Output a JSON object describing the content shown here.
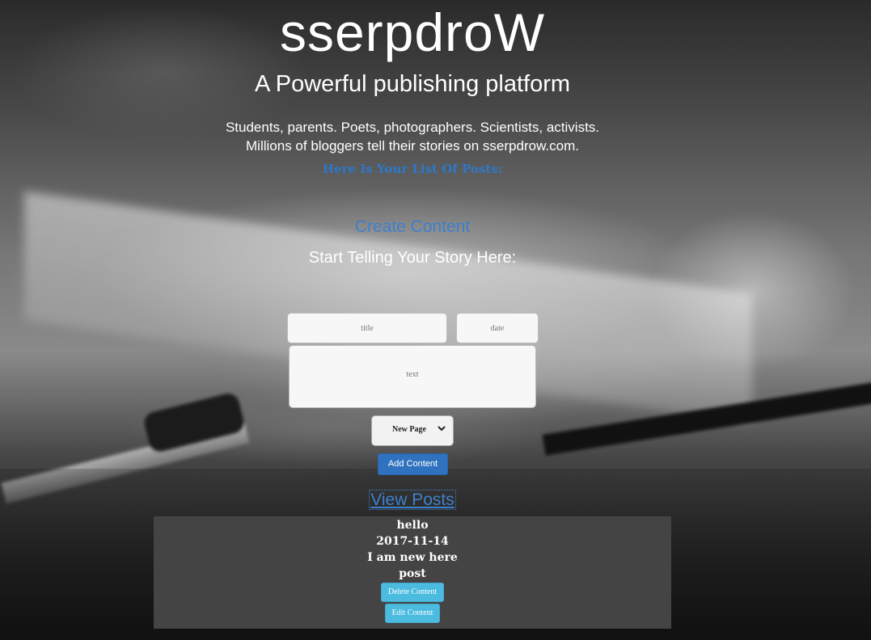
{
  "header": {
    "brand": "sserpdroW",
    "tagline": "A Powerful publishing platform",
    "description_line1": "Students, parents. Poets, photographers. Scientists, activists.",
    "description_line2": "Millions of bloggers tell their stories on sserpdrow.com.",
    "list_heading": "Here Is Your List Of Posts:"
  },
  "create": {
    "heading": "Create Content",
    "subheading": "Start Telling Your Story Here:",
    "title_placeholder": "title",
    "date_placeholder": "date",
    "text_placeholder": "text",
    "type_selected": "New Page",
    "add_button": "Add Content"
  },
  "view": {
    "link": "View Posts"
  },
  "posts": [
    {
      "title": "hello",
      "date": "2017-11-14",
      "text": "I am new here",
      "type": "post",
      "delete_label": "Delete Content",
      "edit_label": "Edit Content"
    }
  ],
  "colors": {
    "link_blue": "#3d80cc",
    "heading_blue": "#2d78c9",
    "primary_button": "#2f72bf",
    "info_button": "#4bbbe0",
    "panel": "#444444"
  },
  "icons": {
    "select_arrow": "chevron-down-icon"
  }
}
